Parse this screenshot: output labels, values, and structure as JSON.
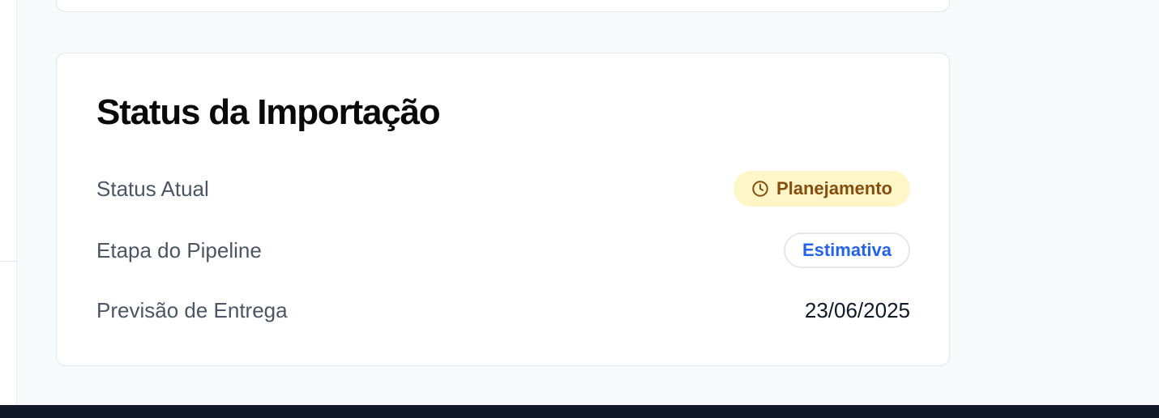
{
  "status_card": {
    "title": "Status da Importação",
    "rows": [
      {
        "label": "Status Atual",
        "value": "Planejamento",
        "icon": "clock-icon"
      },
      {
        "label": "Etapa do Pipeline",
        "value": "Estimativa"
      },
      {
        "label": "Previsão de Entrega",
        "value": "23/06/2025"
      }
    ]
  },
  "colors": {
    "status_badge_bg": "#fef6c7",
    "status_badge_text": "#854d0e",
    "stage_badge_text": "#2563eb",
    "footer": "#111827"
  }
}
